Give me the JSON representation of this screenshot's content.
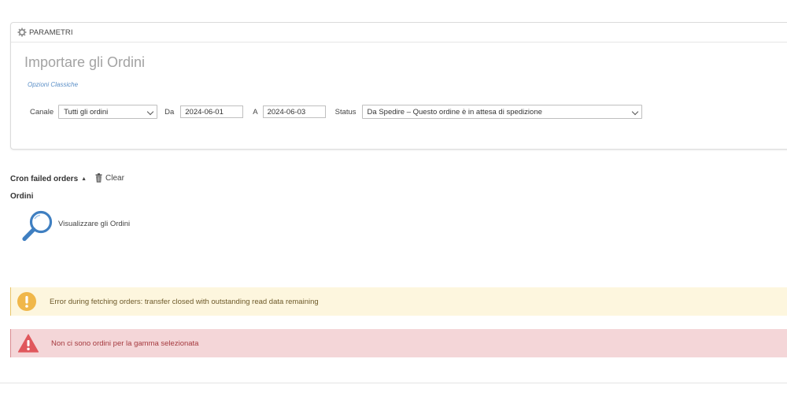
{
  "panel": {
    "header": "PARAMETRI",
    "title": "Importare gli Ordini",
    "sublink": "Opzioni Classiche",
    "filters": {
      "channel_label": "Canale",
      "channel_value": "Tutti gli ordini",
      "from_label": "Da",
      "from_value": "2024-06-01",
      "to_label": "A",
      "to_value": "2024-06-03",
      "status_label": "Status",
      "status_value": "Da Spedire – Questo ordine è in attesa di spedizione"
    }
  },
  "cron": {
    "label": "Cron failed orders",
    "caret": "▲",
    "clear_label": "Clear"
  },
  "orders": {
    "heading": "Ordini",
    "view_label": "Visualizzare gli Ordini"
  },
  "alerts": {
    "warning": "Error during fetching orders: transfer closed with outstanding read data remaining",
    "error": "Non ci sono ordini per la gamma selezionata"
  },
  "colors": {
    "warning_bg": "#fdf6de",
    "warning_icon": "#f0b74a",
    "error_bg": "#f4d6d8",
    "error_icon": "#e0575c",
    "link": "#5b8fc7",
    "magnifier": "#3f7fc1"
  },
  "icons": {
    "panel_header": "gear-icon",
    "clear": "trash-icon",
    "view_orders": "magnifier-icon",
    "warning": "exclamation-circle-icon",
    "error": "warning-triangle-icon"
  }
}
